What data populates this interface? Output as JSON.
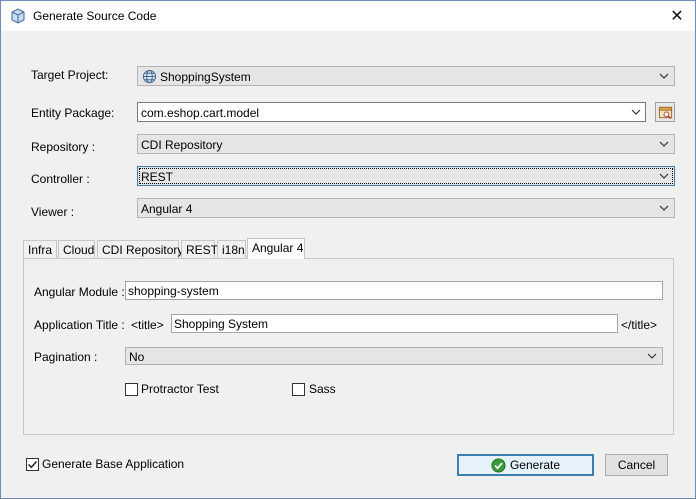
{
  "window": {
    "title": "Generate Source Code",
    "app_icon": "cube-icon",
    "close_glyph": "✕"
  },
  "form": {
    "target_project": {
      "label": "Target Project:",
      "value": "ShoppingSystem",
      "icon": "globe-project-icon"
    },
    "entity_package": {
      "label": "Entity Package:",
      "value": "com.eshop.cart.model"
    },
    "repository": {
      "label": "Repository :",
      "value": "CDI Repository"
    },
    "controller": {
      "label": "Controller :",
      "value": "REST"
    },
    "viewer": {
      "label": "Viewer :",
      "value": "Angular 4"
    }
  },
  "tabs": [
    {
      "label": "Infra",
      "active": false
    },
    {
      "label": "Cloud",
      "active": false
    },
    {
      "label": "CDI Repository",
      "active": false
    },
    {
      "label": "REST",
      "active": false
    },
    {
      "label": "i18n",
      "active": false
    },
    {
      "label": "Angular 4",
      "active": true
    }
  ],
  "angular": {
    "module": {
      "label": "Angular Module :",
      "value": "shopping-system"
    },
    "app_title": {
      "label": "Application Title :",
      "prefix": "<title>",
      "value": "Shopping System",
      "suffix": "</title>"
    },
    "pagination": {
      "label": "Pagination :",
      "value": "No"
    },
    "protractor": {
      "label": "Protractor Test",
      "checked": false
    },
    "sass": {
      "label": "Sass",
      "checked": false
    }
  },
  "footer": {
    "base_app": {
      "label": "Generate Base Application",
      "checked": true
    },
    "generate_label": "Generate",
    "cancel_label": "Cancel"
  },
  "colors": {
    "accent": "#3c7fb1",
    "panel": "#f0f0f0",
    "check_green": "#3a9b3a"
  }
}
